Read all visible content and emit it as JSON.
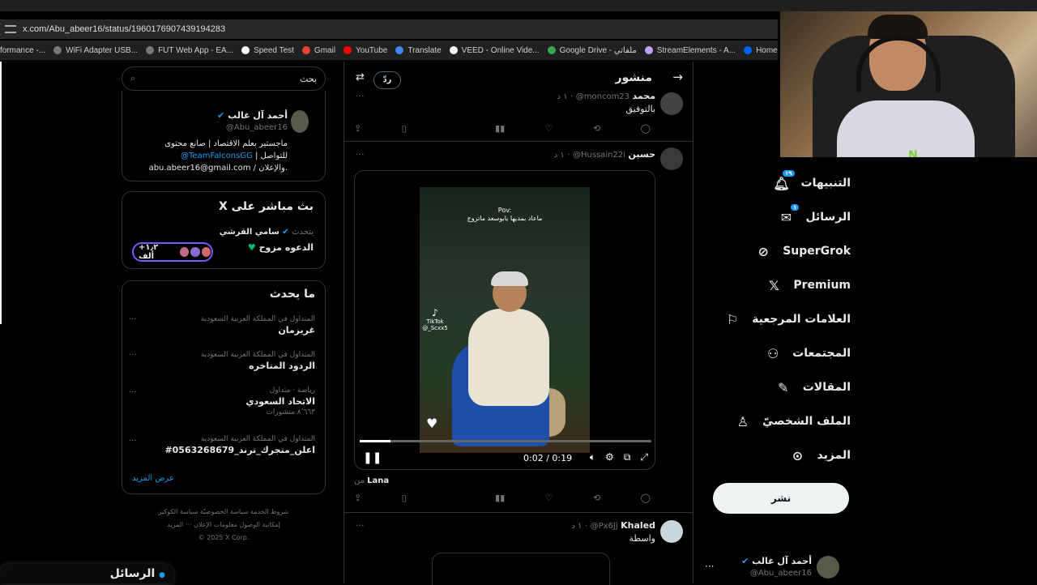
{
  "browser": {
    "url": "x.com/Abu_abeer16/status/1960176907439194283",
    "bookmarks": [
      "formance -...",
      "WiFi Adapter USB...",
      "FUT Web App - EA...",
      "Speed Test",
      "Gmail",
      "YouTube",
      "Translate",
      "VEED - Online Vide...",
      "Google Drive - ملفاتي",
      "StreamElements - A...",
      "Home - Dropbox"
    ]
  },
  "search": {
    "placeholder": "بحث"
  },
  "profile_card": {
    "name": "أحمد آل غالب",
    "handle": "@Abu_abeer16",
    "bio_line1": "ماجستير بعلم الاقتصاد | صانع محتوى",
    "bio_link": "@TeamFalconsGG",
    "bio_line2": "| للتواصل",
    "bio_line3": "abu.abeer16@gmail.com / والإعلان."
  },
  "live_card": {
    "title": "X بث مباشر على",
    "host_prefix": "يتحدث",
    "host": "سامي القرشي",
    "description": "الدعوه مزوح",
    "listeners": "+١٫٢ ألف"
  },
  "trends": {
    "title": "ما يحدث",
    "items": [
      {
        "category": "المتداول في المملكة العربية السعودية",
        "name": "غريزمان",
        "count": ""
      },
      {
        "category": "المتداول في المملكة العربية السعودية",
        "name": "الردود المتاخره",
        "count": ""
      },
      {
        "category": "رياضة · متداول",
        "name": "الاتحاد السعودي",
        "count": "٨٬٦٦٣ منشورات"
      },
      {
        "category": "المتداول في المملكة العربية السعودية",
        "name": "#اعلن_متجرك_ترند_0563268679",
        "count": ""
      }
    ],
    "show_more": "عرض المزيد"
  },
  "footer": {
    "line1": "شروط الخدمة   سياسة الخصوصيّة   سياسة الكوكيز",
    "line2": "إمكانية الوصول   معلومات الإعلان   ··· المزيد",
    "line3": "© 2025 X Corp."
  },
  "messages_drawer": {
    "label": "الرسائل"
  },
  "header": {
    "title": "منشور",
    "reply_label": "ردّ"
  },
  "tweets": [
    {
      "name": "محمد",
      "handle": "@moncom23",
      "time": "١ د",
      "text": "بالتوفيق"
    },
    {
      "name": "حسين",
      "handle": "@Hussain22i",
      "time": "١ د",
      "text": ""
    },
    {
      "name": "Khaled",
      "handle": "@Px6Jj",
      "time": "١ د",
      "text": "واسطة"
    }
  ],
  "video": {
    "pov_line1": "Pov:",
    "pov_line2": "ماعاد بمديها يابوسعد ماتزوج",
    "tiktok": "TikTok",
    "tiktok_user": "@_Scxx5",
    "time": "0:02 / 0:19",
    "progress": 0.105,
    "from_prefix": "من",
    "from_user": "Lana"
  },
  "nav": {
    "items": [
      {
        "label": "التنبيهات",
        "icon": "bell-icon",
        "badge": "١٩"
      },
      {
        "label": "الرسائل",
        "icon": "mail-icon",
        "badge": "١"
      },
      {
        "label": "SuperGrok",
        "icon": "grok-icon",
        "badge": ""
      },
      {
        "label": "Premium",
        "icon": "x-logo-icon",
        "badge": ""
      },
      {
        "label": "العلامات المرجعية",
        "icon": "bookmark-icon",
        "badge": ""
      },
      {
        "label": "المجتمعات",
        "icon": "communities-icon",
        "badge": ""
      },
      {
        "label": "المقالات",
        "icon": "articles-icon",
        "badge": ""
      },
      {
        "label": "الملف الشخصيّ",
        "icon": "profile-icon",
        "badge": ""
      },
      {
        "label": "المزيد",
        "icon": "more-icon",
        "badge": ""
      }
    ],
    "post_label": "نشر"
  },
  "me": {
    "name": "أحمد آل غالب",
    "handle": "@Abu_abeer16"
  },
  "colors": {
    "accent": "#1d9bf0",
    "background": "#000000",
    "border": "#2f3336",
    "muted": "#71767b"
  }
}
